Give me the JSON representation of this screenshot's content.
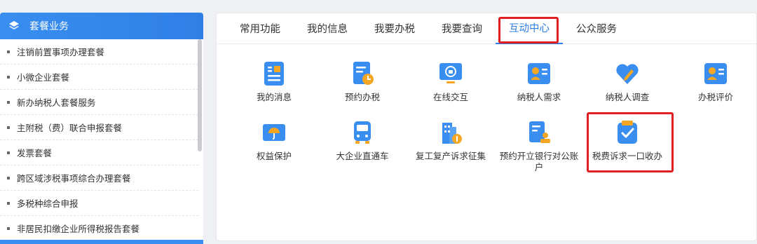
{
  "sidebar": {
    "title": "套餐业务",
    "items": [
      {
        "label": "注销前置事项办理套餐"
      },
      {
        "label": "小微企业套餐"
      },
      {
        "label": "新办纳税人套餐服务"
      },
      {
        "label": "主附税（费）联合申报套餐"
      },
      {
        "label": "发票套餐"
      },
      {
        "label": "跨区域涉税事项综合办理套餐"
      },
      {
        "label": "多税种综合申报"
      },
      {
        "label": "非居民扣缴企业所得税报告套餐"
      }
    ]
  },
  "tabs": [
    {
      "label": "常用功能"
    },
    {
      "label": "我的信息"
    },
    {
      "label": "我要办税"
    },
    {
      "label": "我要查询"
    },
    {
      "label": "互动中心"
    },
    {
      "label": "公众服务"
    }
  ],
  "active_tab": "互动中心",
  "tiles": [
    {
      "label": "我的消息",
      "icon": "message-icon"
    },
    {
      "label": "预约办税",
      "icon": "appointment-icon"
    },
    {
      "label": "在线交互",
      "icon": "monitor-icon"
    },
    {
      "label": "纳税人需求",
      "icon": "profile-card-icon"
    },
    {
      "label": "纳税人调查",
      "icon": "heart-pen-icon"
    },
    {
      "label": "办税评价",
      "icon": "rating-card-icon"
    },
    {
      "label": "权益保护",
      "icon": "umbrella-icon"
    },
    {
      "label": "大企业直通车",
      "icon": "bus-icon"
    },
    {
      "label": "复工复产诉求征集",
      "icon": "building-icon"
    },
    {
      "label": "预约开立银行对公账户",
      "icon": "bank-account-icon"
    },
    {
      "label": "税费诉求一口收办",
      "icon": "clipboard-check-icon"
    }
  ],
  "colors": {
    "accent": "#2f7fe6",
    "highlight": "#e02020",
    "icon_blue": "#3a8ef0",
    "icon_orange": "#f5a623"
  }
}
